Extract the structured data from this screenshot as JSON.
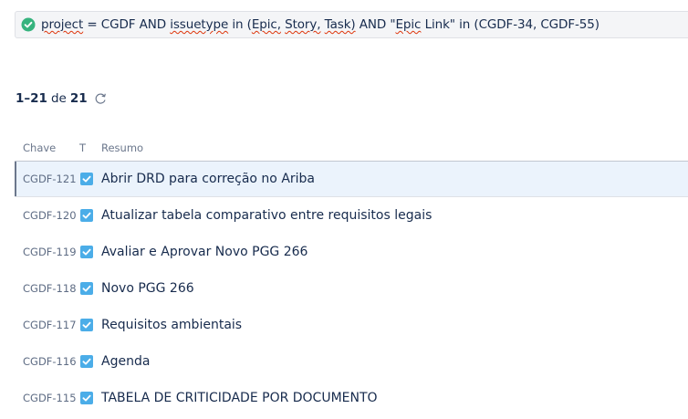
{
  "jql": {
    "icon": "check-circle-icon",
    "color_valid": "#36b37e",
    "parts": [
      {
        "text": "project",
        "squiggle": true
      },
      {
        "text": " = CGDF AND ",
        "squiggle": false
      },
      {
        "text": "issuetype",
        "squiggle": true
      },
      {
        "text": " in (",
        "squiggle": false
      },
      {
        "text": "Epic,",
        "squiggle": true
      },
      {
        "text": " ",
        "squiggle": false
      },
      {
        "text": "Story,",
        "squiggle": true
      },
      {
        "text": " ",
        "squiggle": false
      },
      {
        "text": "Task)",
        "squiggle": true
      },
      {
        "text": " AND \"",
        "squiggle": false
      },
      {
        "text": "Epic",
        "squiggle": true
      },
      {
        "text": " Link\" in (CGDF-34, CGDF-55)",
        "squiggle": false
      }
    ]
  },
  "results": {
    "range": "1–21",
    "of_label": "de",
    "total": "21",
    "refresh_icon": "refresh-icon"
  },
  "columns": {
    "key": "Chave",
    "type": "T",
    "summary": "Resumo"
  },
  "issue_type_icon": "task-checkbox-icon",
  "issue_type_color": "#4bade8",
  "rows": [
    {
      "key": "CGDF-121",
      "summary": "Abrir DRD para correção no Ariba",
      "selected": true
    },
    {
      "key": "CGDF-120",
      "summary": "Atualizar tabela comparativo entre requisitos legais",
      "selected": false
    },
    {
      "key": "CGDF-119",
      "summary": "Avaliar e Aprovar Novo PGG 266",
      "selected": false
    },
    {
      "key": "CGDF-118",
      "summary": "Novo PGG 266",
      "selected": false
    },
    {
      "key": "CGDF-117",
      "summary": "Requisitos ambientais",
      "selected": false
    },
    {
      "key": "CGDF-116",
      "summary": "Agenda",
      "selected": false
    },
    {
      "key": "CGDF-115",
      "summary": "TABELA DE CRITICIDADE POR DOCUMENTO",
      "selected": false
    }
  ]
}
